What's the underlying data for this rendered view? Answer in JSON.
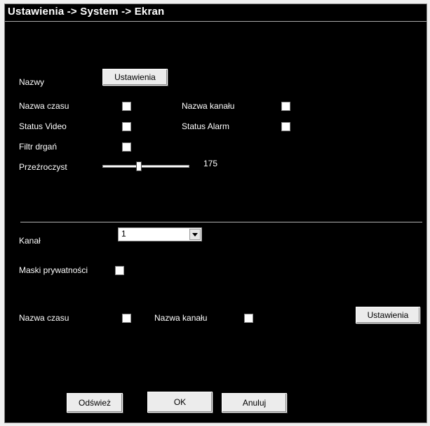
{
  "title": "Ustawienia -> System -> Ekran",
  "names_section": {
    "label": "Nazwy",
    "settings_button": "Ustawienia",
    "time_name": "Nazwa czasu",
    "channel_name": "Nazwa kanału",
    "video_status": "Status Video",
    "alarm_status": "Status Alarm",
    "anti_shake": "Filtr drgań",
    "transparency": "Przeźroczyst",
    "transparency_value": "175"
  },
  "channel_section": {
    "channel_label": "Kanał",
    "channel_value": "1",
    "privacy_masks": "Maski prywatności",
    "time_name": "Nazwa czasu",
    "channel_name": "Nazwa kanału",
    "settings_button": "Ustawienia"
  },
  "footer": {
    "refresh": "Odśwież",
    "ok": "OK",
    "cancel": "Anuluj"
  }
}
